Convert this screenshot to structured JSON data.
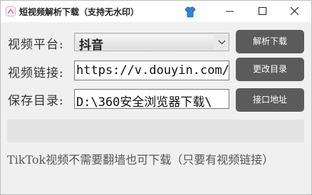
{
  "window": {
    "title": "短视频解析下载（支持无水印）",
    "min_icon": "minimize-icon",
    "max_icon": "maximize-icon",
    "close_icon": "close-icon"
  },
  "form": {
    "platform_label": "视频平台:",
    "platform_value": "抖音",
    "link_label": "视频链接:",
    "link_value": "https://v.douyin.com/",
    "dir_label": "保存目录:",
    "dir_value": "D:\\360安全浏览器下载\\"
  },
  "buttons": {
    "parse": "解析下载",
    "change_dir": "更改目录",
    "api": "接口地址"
  },
  "progress": {
    "value": 0
  },
  "tip": "TikTok视频不需要翻墙也可下载（只要有视频链接）",
  "colors": {
    "button_bg": "#5b5b5b",
    "progress_track": "#e3e3e3"
  }
}
